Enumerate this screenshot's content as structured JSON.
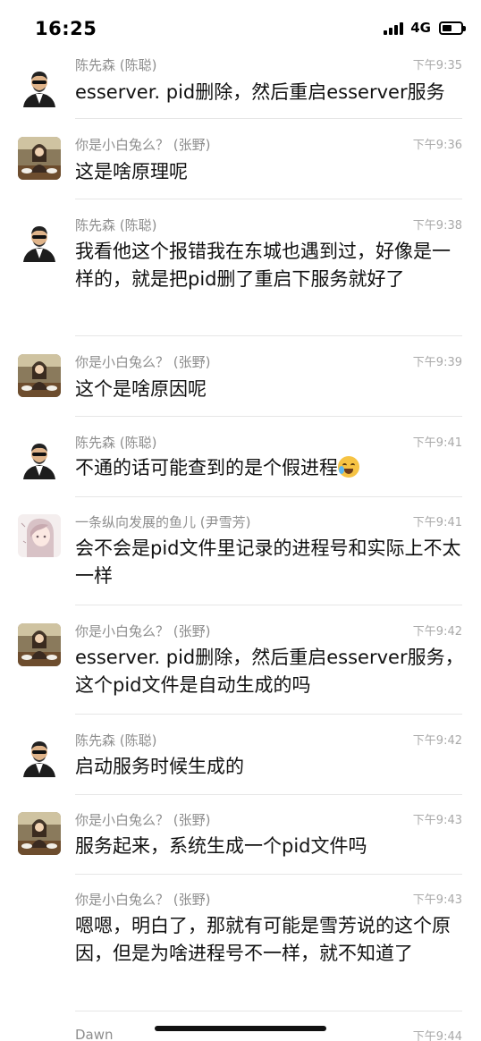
{
  "status_bar": {
    "time": "16:25",
    "network": "4G"
  },
  "messages": [
    {
      "sender": "陈先森 (陈聪)",
      "time": "下午9:35",
      "avatar": "man-suit-avatar",
      "text": "esserver. pid删除，然后重启esserver服务"
    },
    {
      "sender": "你是小白兔么？ (张野)",
      "time": "下午9:36",
      "avatar": "girl-photo-avatar",
      "text": "这是啥原理呢"
    },
    {
      "sender": "陈先森 (陈聪)",
      "time": "下午9:38",
      "avatar": "man-suit-avatar",
      "text": "我看他这个报错我在东城也遇到过，好像是一样的，就是把pid删了重启下服务就好了"
    },
    {
      "sender": "你是小白兔么？ (张野)",
      "time": "下午9:39",
      "avatar": "girl-photo-avatar",
      "text": "这个是啥原因呢"
    },
    {
      "sender": "陈先森 (陈聪)",
      "time": "下午9:41",
      "avatar": "man-suit-avatar",
      "text": "不通的话可能查到的是个假进程",
      "emoji": "laugh-cry-emoji"
    },
    {
      "sender": "一条纵向发展的鱼儿 (尹雪芳)",
      "time": "下午9:41",
      "avatar": "anime-girl-avatar",
      "text": "会不会是pid文件里记录的进程号和实际上不太一样"
    },
    {
      "sender": "你是小白兔么？ (张野)",
      "time": "下午9:42",
      "avatar": "girl-photo-avatar",
      "text": "esserver. pid删除，然后重启esserver服务，这个pid文件是自动生成的吗"
    },
    {
      "sender": "陈先森 (陈聪)",
      "time": "下午9:42",
      "avatar": "man-suit-avatar",
      "text": "启动服务时候生成的"
    },
    {
      "sender": "你是小白兔么？ (张野)",
      "time": "下午9:43",
      "avatar": "girl-photo-avatar",
      "text": "服务起来，系统生成一个pid文件吗"
    },
    {
      "sender": "你是小白兔么？ (张野)",
      "time": "下午9:43",
      "avatar": "",
      "text": "嗯嗯，明白了，那就有可能是雪芳说的这个原因，但是为啥进程号不一样，就不知道了"
    },
    {
      "sender": "Dawn",
      "time": "下午9:44",
      "avatar": "",
      "text": ""
    }
  ]
}
